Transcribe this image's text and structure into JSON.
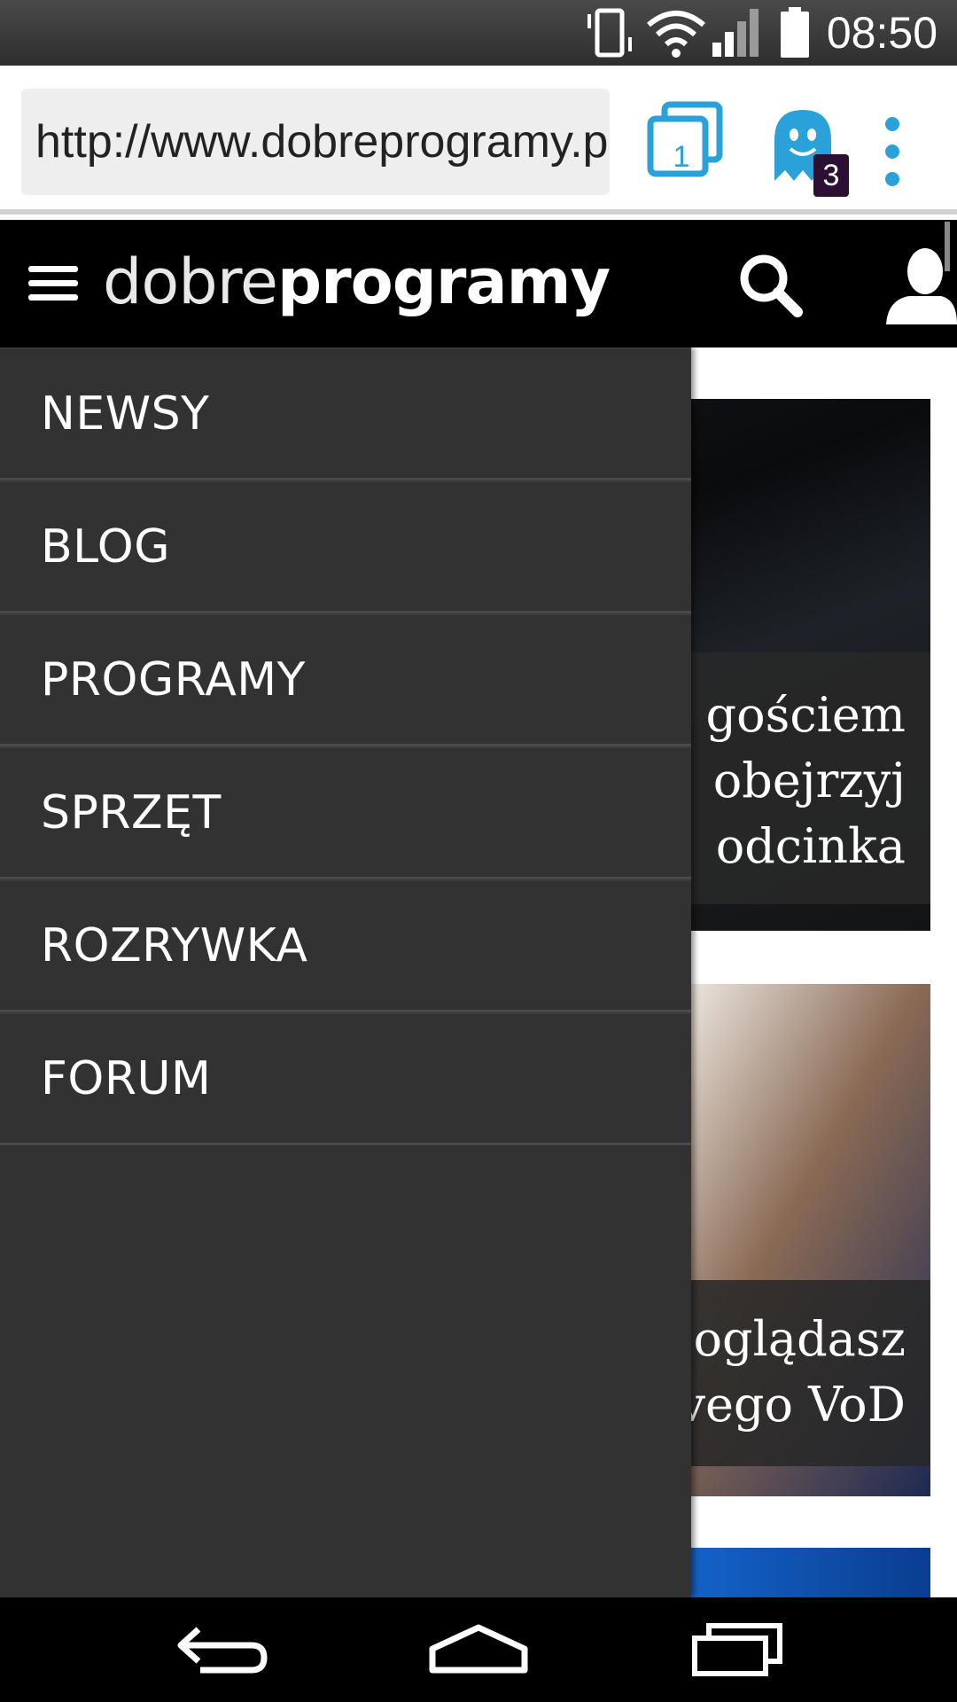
{
  "status_bar": {
    "time": "08:50",
    "icons": [
      "vibrate-icon",
      "wifi-icon",
      "signal-icon",
      "battery-icon"
    ]
  },
  "browser": {
    "url": "http://www.dobreprogramy.pl",
    "tab_count": "1",
    "ghostery_badge": "3",
    "icons": [
      "tabs-icon",
      "ghost-icon",
      "overflow-menu-icon"
    ]
  },
  "site_header": {
    "logo_light": "dobre",
    "logo_bold": "programy",
    "icons": [
      "hamburger-icon",
      "search-icon",
      "user-icon"
    ]
  },
  "drawer": {
    "items": [
      "NEWSY",
      "BLOG",
      "PROGRAMY",
      "SPRZĘT",
      "ROZRYWKA",
      "FORUM"
    ]
  },
  "content": {
    "cards": [
      {
        "caption_lines": [
          "gościem",
          "obejrzyj",
          "odcinka"
        ]
      },
      {
        "caption_lines": [
          "oglądasz",
          "vego VoD"
        ]
      }
    ]
  },
  "nav_bar": {
    "icons": [
      "back-icon",
      "home-icon",
      "recents-icon"
    ]
  },
  "colors": {
    "accent": "#2aa1d9",
    "drawer_bg": "#323232",
    "header_bg": "#000000"
  }
}
